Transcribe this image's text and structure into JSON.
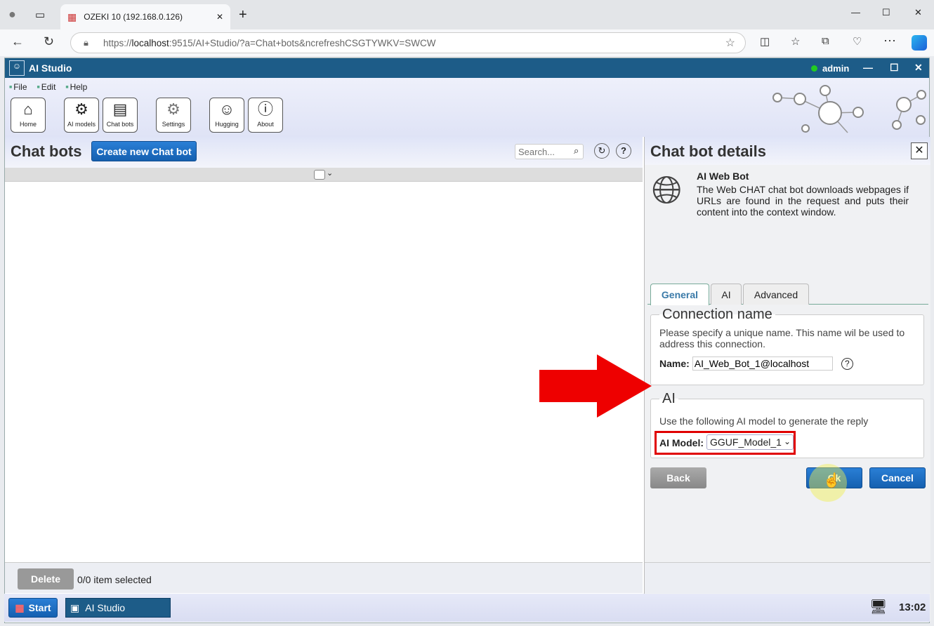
{
  "browser": {
    "tab_title": "OZEKI 10 (192.168.0.126)",
    "url_prefix": "https://",
    "url_host": "localhost",
    "url_rest": ":9515/AI+Studio/?a=Chat+bots&ncrefreshCSGTYWKV=SWCW"
  },
  "app": {
    "title": "AI Studio",
    "user": "admin"
  },
  "menu": [
    "File",
    "Edit",
    "Help"
  ],
  "toolbar": [
    {
      "label": "Home",
      "icon": "home-icon"
    },
    {
      "label": "AI models",
      "icon": "ai-models-icon"
    },
    {
      "label": "Chat bots",
      "icon": "chat-bots-icon"
    },
    {
      "label": "Settings",
      "icon": "gear-icon"
    },
    {
      "label": "Hugging",
      "icon": "hugging-face-icon"
    },
    {
      "label": "About",
      "icon": "info-icon"
    }
  ],
  "left": {
    "title": "Chat bots",
    "create_label": "Create new Chat bot",
    "search_placeholder": "Search...",
    "delete_label": "Delete",
    "selection_status": "0/0 item selected"
  },
  "details": {
    "title": "Chat bot details",
    "bot_name": "AI Web Bot",
    "bot_desc": "The Web CHAT chat bot downloads webpages if URLs are found in the request and puts their content into the context window.",
    "tabs": [
      "General",
      "AI",
      "Advanced"
    ],
    "active_tab": "General",
    "conn_legend": "Connection name",
    "conn_help": "Please specify a unique name. This name wil be used to address this connection.",
    "name_label": "Name:",
    "name_value": "AI_Web_Bot_1@localhost",
    "ai_legend": "AI",
    "ai_help": "Use the following AI model to generate the reply",
    "model_label": "AI Model:",
    "model_value": "GGUF_Model_1",
    "back_label": "Back",
    "ok_label": "Ok",
    "cancel_label": "Cancel"
  },
  "taskbar": {
    "start_label": "Start",
    "app_label": "AI Studio",
    "clock": "13:02"
  },
  "colors": {
    "accent": "#1d5c88",
    "button": "#1a6cc4",
    "highlight": "#e00000"
  }
}
